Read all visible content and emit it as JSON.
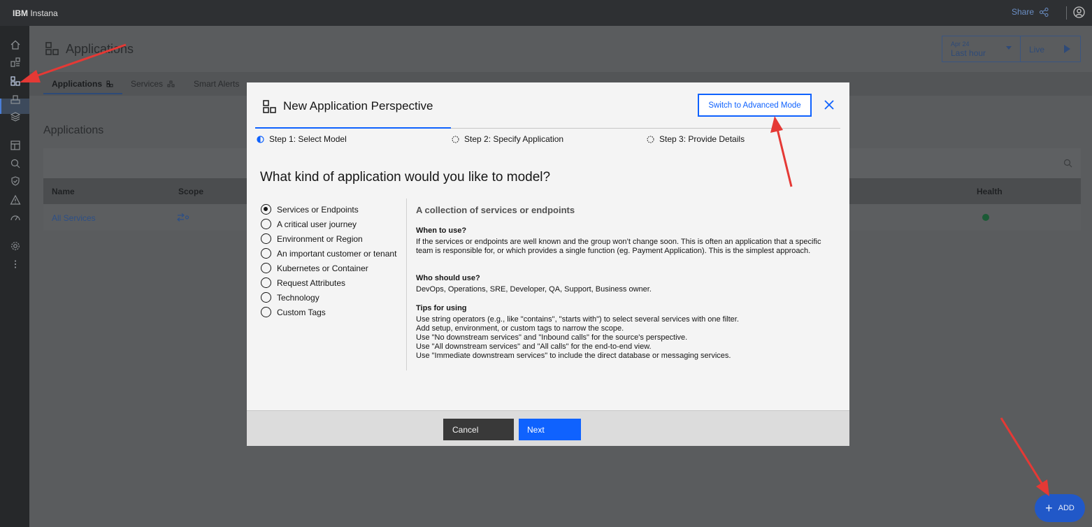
{
  "topbar": {
    "brand_bold": "IBM",
    "brand_rest": " Instana",
    "share_label": "Share"
  },
  "page": {
    "title": "Applications",
    "time": {
      "date": "Apr 24",
      "range": "Last hour",
      "live": "Live"
    },
    "tabs": [
      {
        "label": "Applications"
      },
      {
        "label": "Services"
      },
      {
        "label": "Smart Alerts"
      }
    ],
    "section_title": "Applications",
    "table": {
      "headers": {
        "name": "Name",
        "scope": "Scope",
        "health": "Health"
      },
      "rows": [
        {
          "name": "All Services"
        }
      ]
    },
    "add_label": "ADD"
  },
  "modal": {
    "title": "New Application Perspective",
    "advanced_label": "Switch to Advanced Mode",
    "steps": [
      {
        "label": "Step 1: Select Model"
      },
      {
        "label": "Step 2: Specify Application"
      },
      {
        "label": "Step 3: Provide Details"
      }
    ],
    "question": "What kind of application would you like to model?",
    "options": [
      {
        "label": "Services or Endpoints",
        "selected": true
      },
      {
        "label": "A critical user journey"
      },
      {
        "label": "Environment or Region"
      },
      {
        "label": "An important customer or tenant"
      },
      {
        "label": "Kubernetes or Container"
      },
      {
        "label": "Request Attributes"
      },
      {
        "label": "Technology"
      },
      {
        "label": "Custom Tags"
      }
    ],
    "description": {
      "title": "A collection of services or endpoints",
      "when_heading": "When to use?",
      "when_text": "If the services or endpoints are well known and the group won’t change soon. This is often an application that a specific team is responsible for, or which provides a single function (eg. Payment Application). This is the simplest approach.",
      "who_heading": "Who should use?",
      "who_text": "DevOps, Operations, SRE, Developer, QA, Support, Business owner.",
      "tips_heading": "Tips for using",
      "tips": [
        "Use string operators (e.g., like \"contains\", \"starts with\") to select several services with one filter.",
        "Add setup, environment, or custom tags to narrow the scope.",
        "Use \"No downstream services\" and \"Inbound calls\" for the source's perspective.",
        "Use \"All downstream services\" and \"All calls\" for the end-to-end view.",
        "Use \"Immediate downstream services\" to include the direct database or messaging services."
      ]
    },
    "cancel_label": "Cancel",
    "next_label": "Next"
  },
  "colors": {
    "accent": "#0f62fe",
    "annotation": "#e53935",
    "success": "#24a148"
  },
  "icons": [
    "home-icon",
    "applications-icon",
    "services-icon",
    "gear-icon",
    "share-icon",
    "user-icon",
    "close-icon",
    "play-icon",
    "plus-icon"
  ]
}
